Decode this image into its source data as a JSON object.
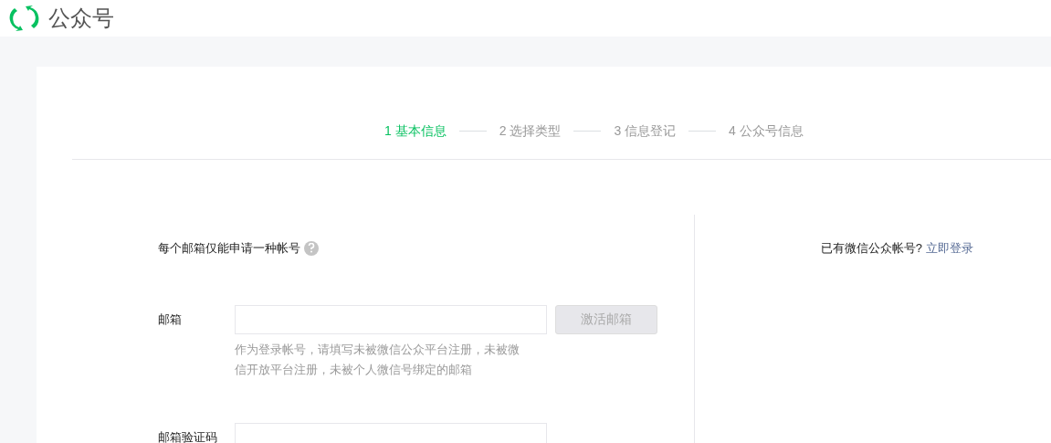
{
  "header": {
    "title": "公众号"
  },
  "steps": [
    {
      "label": "1 基本信息",
      "selected": true
    },
    {
      "label": "2 选择类型",
      "selected": false
    },
    {
      "label": "3 信息登记",
      "selected": false
    },
    {
      "label": "4 公众号信息",
      "selected": false
    }
  ],
  "notice": {
    "text": "每个邮箱仅能申请一种帐号"
  },
  "fields": [
    {
      "label": "邮箱",
      "button": "激活邮箱",
      "button_disabled": true,
      "hint": "作为登录帐号，请填写未被微信公众平台注册，未被微信开放平台注册，未被个人微信号绑定的邮箱"
    },
    {
      "label": "邮箱验证码"
    }
  ],
  "login": {
    "text": "已有微信公众帐号?",
    "link": "立即登录"
  }
}
